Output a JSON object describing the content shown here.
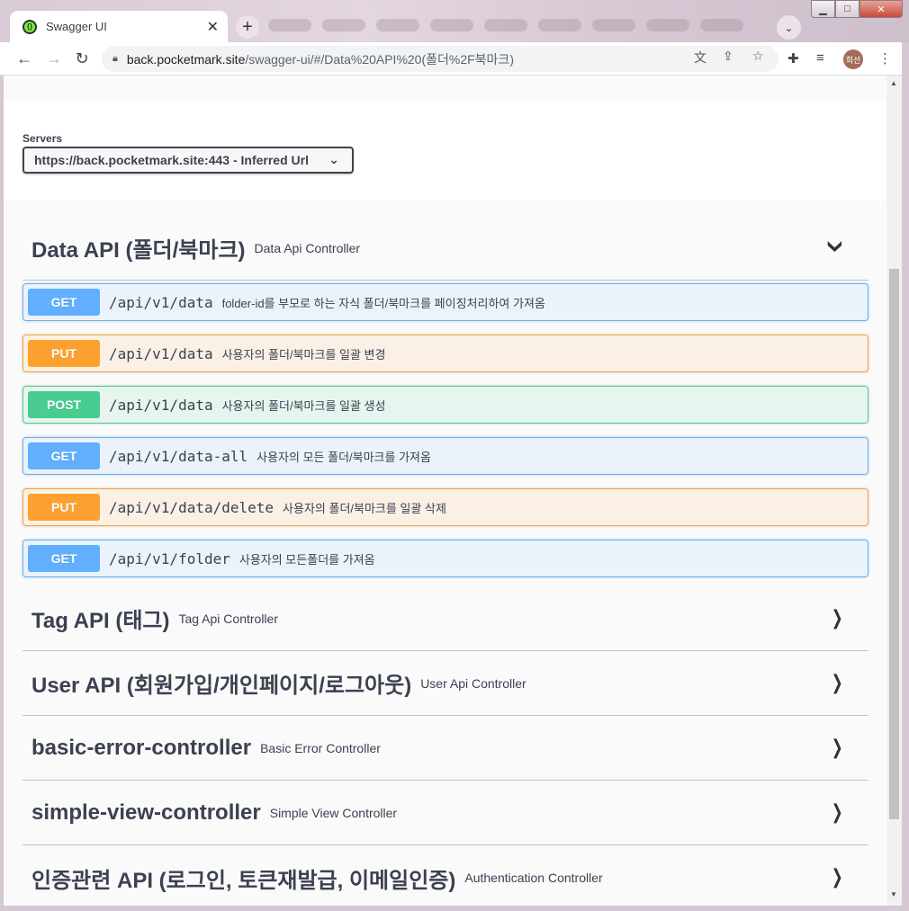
{
  "browser": {
    "tab_title": "Swagger UI",
    "tab_close": "✕",
    "new_tab": "+",
    "url_host": "back.pocketmark.site",
    "url_path": "/swagger-ui/#/Data%20API%20(폴더%2F북마크)",
    "avatar_initials": "희선",
    "icons": [
      "back-arrow-icon",
      "forward-arrow-icon",
      "reload-icon",
      "lock-icon",
      "translate-icon",
      "share-icon",
      "star-icon",
      "extensions-icon",
      "media-icon",
      "menu-icon"
    ]
  },
  "servers": {
    "label": "Servers",
    "selected": "https://back.pocketmark.site:443 - Inferred Url"
  },
  "colors": {
    "get": "#61affe",
    "put": "#fca130",
    "post": "#49cc90",
    "text": "#3b4151"
  },
  "tags": [
    {
      "title": "Data API (폴더/북마크)",
      "description": "Data Api Controller",
      "expanded": true,
      "operations": [
        {
          "method": "GET",
          "path": "/api/v1/data",
          "summary": "folder-id를 부모로 하는 자식 폴더/북마크를 페이징처리하여 가져옴"
        },
        {
          "method": "PUT",
          "path": "/api/v1/data",
          "summary": "사용자의 폴더/북마크를 일괄 변경"
        },
        {
          "method": "POST",
          "path": "/api/v1/data",
          "summary": "사용자의 폴더/북마크를 일괄 생성"
        },
        {
          "method": "GET",
          "path": "/api/v1/data-all",
          "summary": "사용자의 모든 폴더/북마크를 가져옴"
        },
        {
          "method": "PUT",
          "path": "/api/v1/data/delete",
          "summary": "사용자의 폴더/북마크를 일괄 삭제"
        },
        {
          "method": "GET",
          "path": "/api/v1/folder",
          "summary": "사용자의 모든폴더를 가져옴"
        }
      ]
    },
    {
      "title": "Tag API (태그)",
      "description": "Tag Api Controller",
      "expanded": false
    },
    {
      "title": "User API (회원가입/개인페이지/로그아웃)",
      "description": "User Api Controller",
      "expanded": false
    },
    {
      "title": "basic-error-controller",
      "description": "Basic Error Controller",
      "expanded": false
    },
    {
      "title": "simple-view-controller",
      "description": "Simple View Controller",
      "expanded": false
    },
    {
      "title": "인증관련 API (로그인, 토큰재발급, 이메일인증)",
      "description": "Authentication Controller",
      "expanded": false
    }
  ]
}
